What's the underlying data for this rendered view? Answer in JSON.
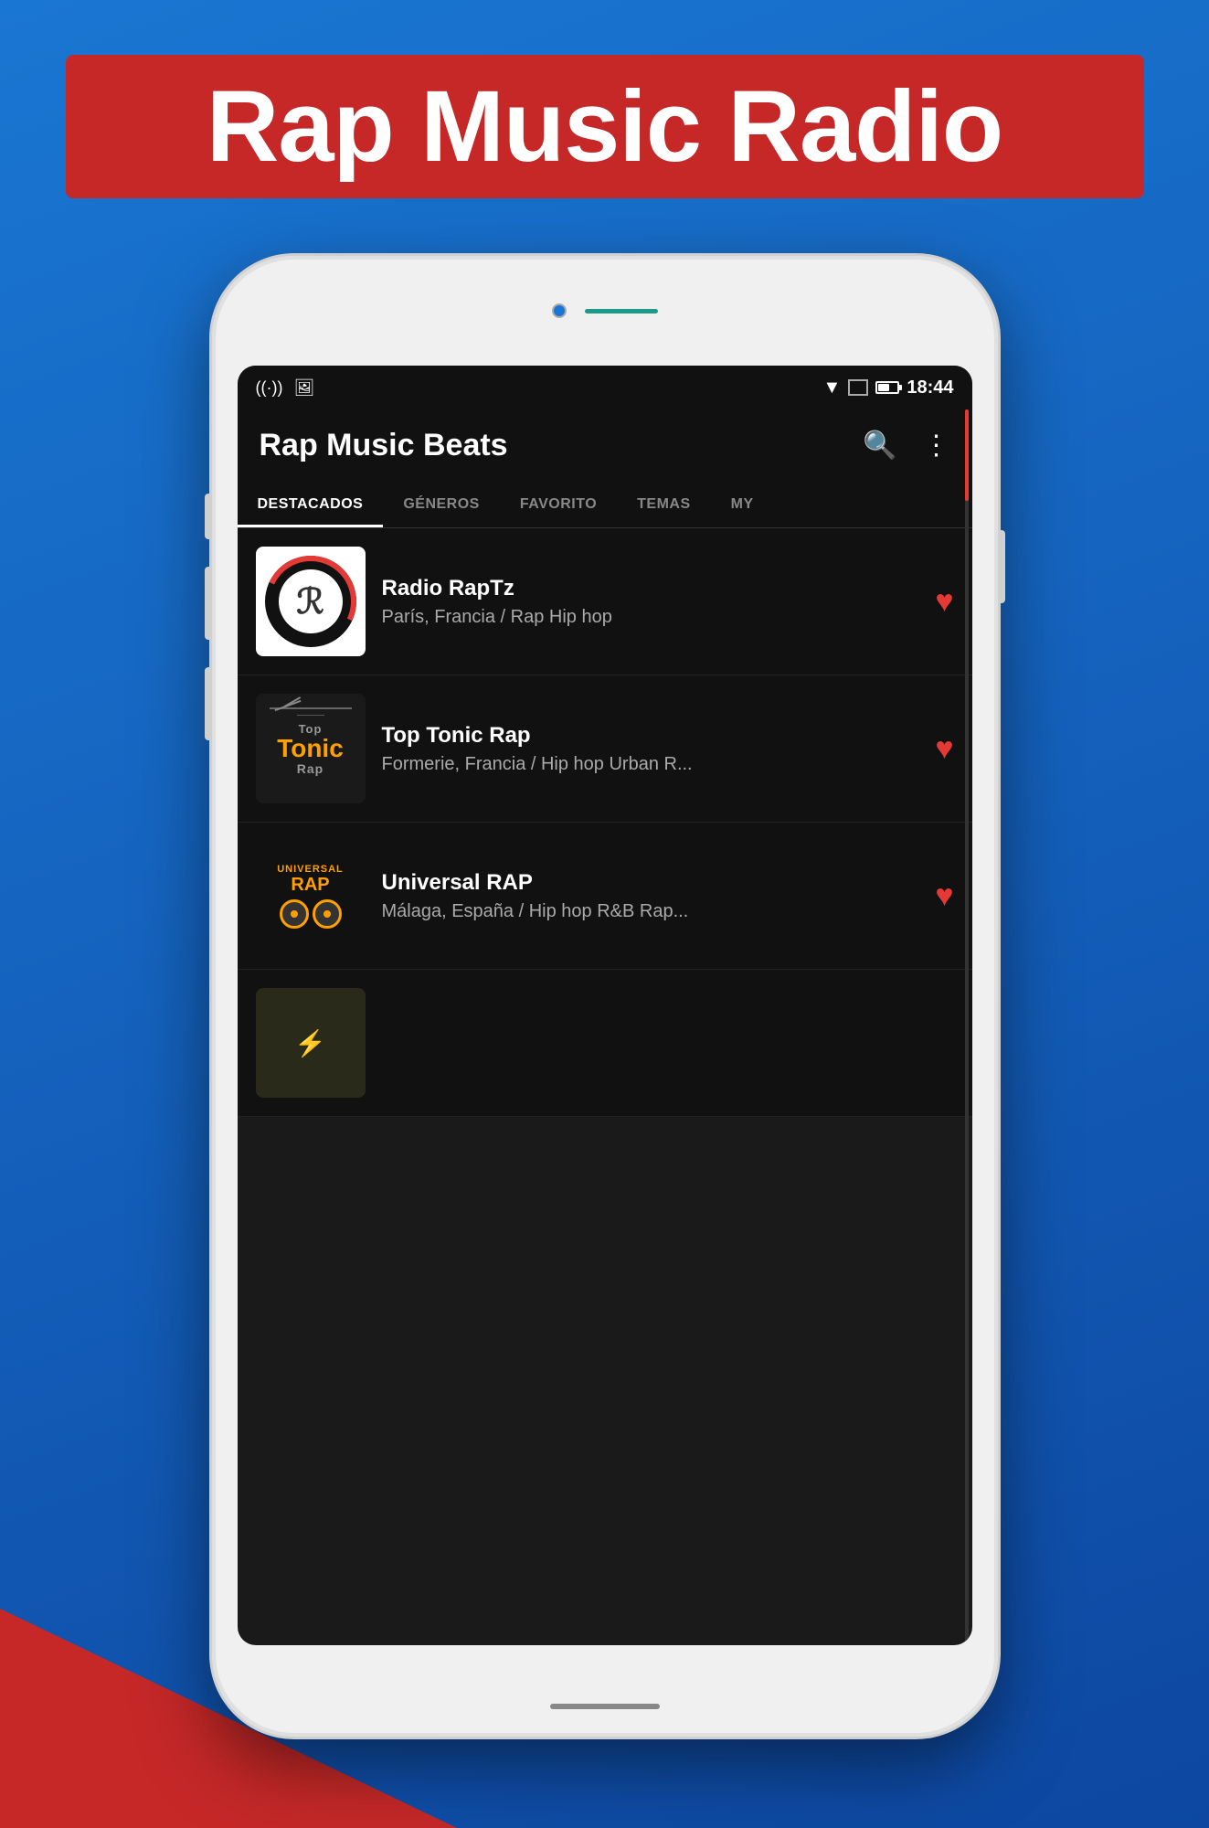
{
  "background": {
    "color": "#1565C0"
  },
  "header": {
    "title": "Rap Music Radio",
    "background": "#C62828"
  },
  "phone": {
    "status_bar": {
      "time": "18:44",
      "icons_left": [
        "radio-icon",
        "image-icon"
      ],
      "icons_right": [
        "wifi-icon",
        "signal-icon",
        "battery-icon"
      ]
    },
    "app": {
      "title": "Rap Music Beats",
      "search_icon": "search",
      "more_icon": "more-vertical"
    },
    "tabs": [
      {
        "label": "DESTACADOS",
        "active": true
      },
      {
        "label": "GÉNEROS",
        "active": false
      },
      {
        "label": "FAVORITO",
        "active": false
      },
      {
        "label": "TEMAS",
        "active": false
      },
      {
        "label": "MY",
        "active": false
      }
    ],
    "radio_stations": [
      {
        "name": "Radio RapTz",
        "subtitle": "París, Francia / Rap Hip hop",
        "favorited": true,
        "logo_type": "raptz"
      },
      {
        "name": "Top Tonic Rap",
        "subtitle": "Formerie, Francia / Hip hop Urban R...",
        "favorited": true,
        "logo_type": "toptonic"
      },
      {
        "name": "Universal RAP",
        "subtitle": "Málaga, España / Hip hop R&B Rap...",
        "favorited": true,
        "logo_type": "universal"
      },
      {
        "name": "",
        "subtitle": "",
        "favorited": false,
        "logo_type": "fourth"
      }
    ]
  }
}
